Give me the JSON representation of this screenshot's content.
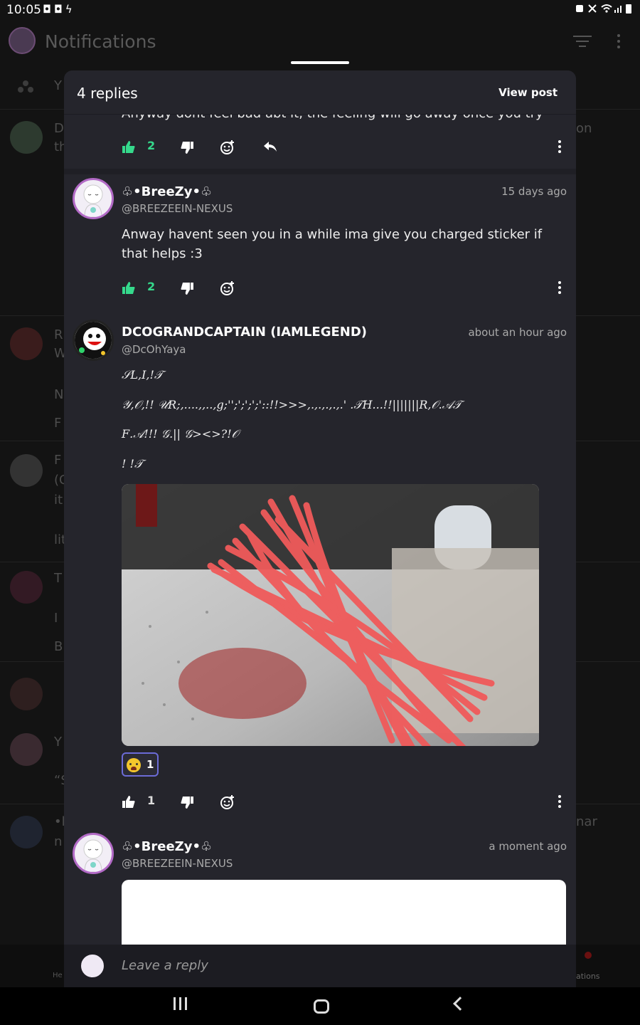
{
  "status_bar": {
    "time": "10:05",
    "left_icons": [
      "game-controller-icon",
      "game-controller-icon",
      "flash-icon"
    ],
    "right_icons": [
      "nfc-icon",
      "mute-icon",
      "wifi-icon",
      "signal-icon",
      "battery-icon"
    ]
  },
  "background": {
    "title": "Notifications",
    "bottom_nav": {
      "home_label_partial": "He",
      "notifications_label_partial": "ations"
    },
    "rows": [
      {
        "letters": "Y"
      },
      {
        "letters": "D",
        "line2": "th",
        "side": "on"
      },
      {
        "letters": "R",
        "line2": "W",
        "line3": "N",
        "line4": "F"
      },
      {
        "letters": "F",
        "line2": "(G",
        "line3": "it",
        "line4": "lit"
      },
      {
        "letters": "T",
        "line2": "I",
        "line3": "B"
      },
      {
        "letters": "Y",
        "line2": "“S"
      },
      {
        "letters": "•l",
        "line2": "n",
        "side": "nar"
      }
    ]
  },
  "sheet": {
    "title": "4 replies",
    "view_post": "View post",
    "cut_text": "Anyway dont feel bad abt it, the feeling will go away once you try",
    "first_actions": {
      "likes": "2"
    },
    "comments": [
      {
        "username": "♧•BreeZy•♧",
        "handle": "@BREEZEEIN-NEXUS",
        "time": "15 days ago",
        "text": "Anway havent seen you in a while ima give you charged sticker if that helps :3",
        "likes": "2"
      },
      {
        "username": "DCOGRANDCAPTAIN (IAMLEGEND)",
        "handle": "@DcOhYaya",
        "time": "about an hour ago",
        "glitch_lines": [
          "𝒮𝐿,𝐼,!𝒯",
          "𝒴,𝒪,!! 𝒰𝑅;,....,,..,g;'';';';';'::!!>>>,.,.,.,.,.' .𝒯𝐻...!!|||||||𝑅,𝒪.𝒜𝒯",
          "𝐹.𝒜!!! 𝒢.|| 𝒢><>?!𝒪",
          "! !𝒯"
        ],
        "reaction": {
          "emoji": "crying-face-emoji",
          "count": "1"
        },
        "likes": "1"
      },
      {
        "username": "♧•BreeZy•♧",
        "handle": "@BREEZEEIN-NEXUS",
        "time": "a moment ago"
      }
    ],
    "reply_placeholder": "Leave a reply"
  },
  "colors": {
    "accent_green": "#35d98c",
    "sheet_bg": "#25252c",
    "reaction_border": "#6b6bd6",
    "scribble_red": "#f05a5a"
  }
}
